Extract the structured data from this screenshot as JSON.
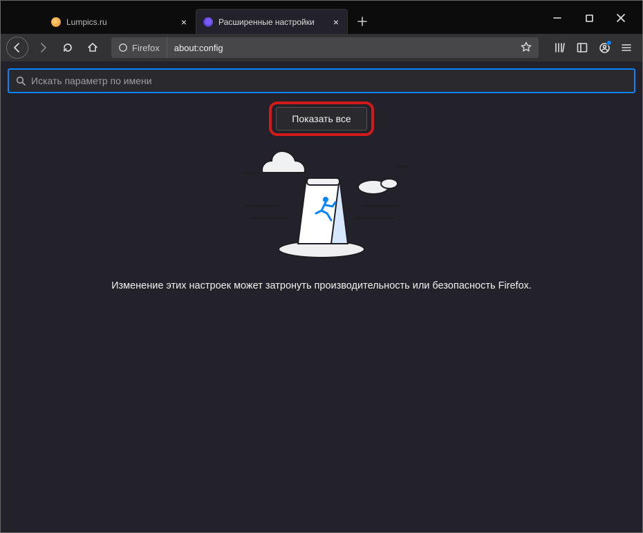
{
  "tabs": [
    {
      "label": "Lumpics.ru"
    },
    {
      "label": "Расширенные настройки"
    }
  ],
  "urlbar": {
    "identity_label": "Firefox",
    "address": "about:config"
  },
  "content": {
    "search_placeholder": "Искать параметр по имени",
    "show_all_label": "Показать все",
    "warning_text": "Изменение этих настроек может затронуть производительность или безопасность Firefox."
  }
}
